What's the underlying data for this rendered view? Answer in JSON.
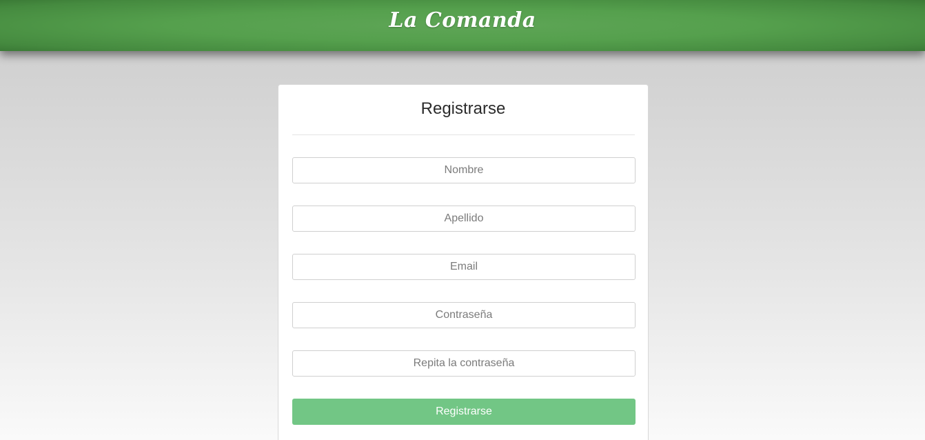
{
  "header": {
    "brand": "La Comanda",
    "brand_color": "#ffffff",
    "bar_color": "#55a04d"
  },
  "form": {
    "title": "Registrarse",
    "fields": [
      {
        "placeholder": "Nombre",
        "value": ""
      },
      {
        "placeholder": "Apellido",
        "value": ""
      },
      {
        "placeholder": "Email",
        "value": ""
      },
      {
        "placeholder": "Contraseña",
        "value": ""
      },
      {
        "placeholder": "Repita la contraseña",
        "value": ""
      }
    ],
    "submit_label": "Registrarse",
    "submit_color": "#72c685"
  }
}
